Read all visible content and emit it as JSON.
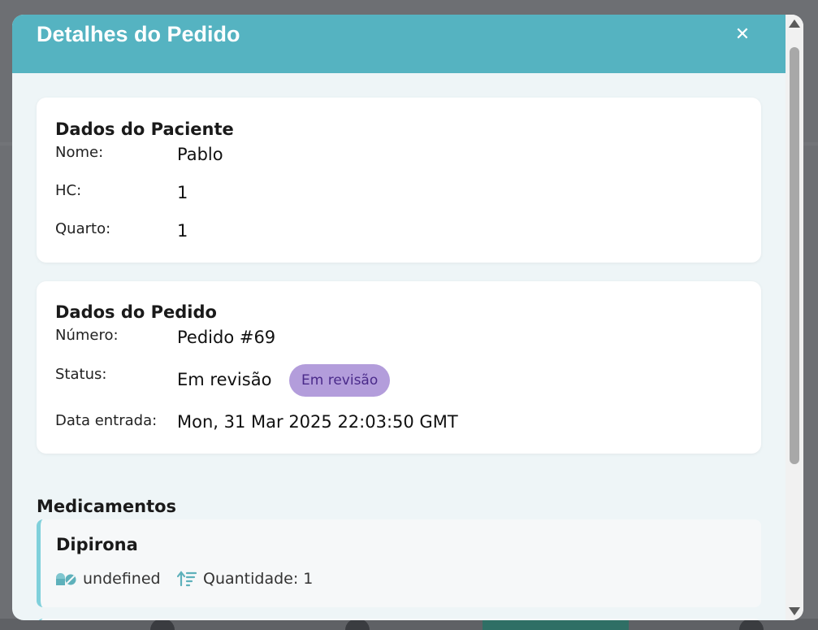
{
  "modal": {
    "title": "Detalhes do Pedido",
    "close_symbol": "✕"
  },
  "patient": {
    "section_title": "Dados do Paciente",
    "fields": [
      {
        "label": "Nome:",
        "value": "Pablo"
      },
      {
        "label": "HC:",
        "value": "1"
      },
      {
        "label": "Quarto:",
        "value": "1"
      }
    ]
  },
  "order": {
    "section_title": "Dados do Pedido",
    "fields": [
      {
        "label": "Número:",
        "value": "Pedido #69"
      },
      {
        "label": "Status:",
        "value": "Em revisão"
      },
      {
        "label": "Data entrada:",
        "value": "Mon, 31 Mar 2025 22:03:50 GMT"
      }
    ],
    "status_badge": "Em revisão",
    "badge_color": "#b39ddb"
  },
  "medications": {
    "section_title": "Medicamentos",
    "items": [
      {
        "name": "Dipirona",
        "type": "undefined",
        "quantity": "Quantidade: 1",
        "type_icon": "pills-icon",
        "quantity_icon": "sort-amount-icon"
      }
    ]
  },
  "colors": {
    "header": "#55b3c1",
    "accent_border": "#7fd0db"
  }
}
